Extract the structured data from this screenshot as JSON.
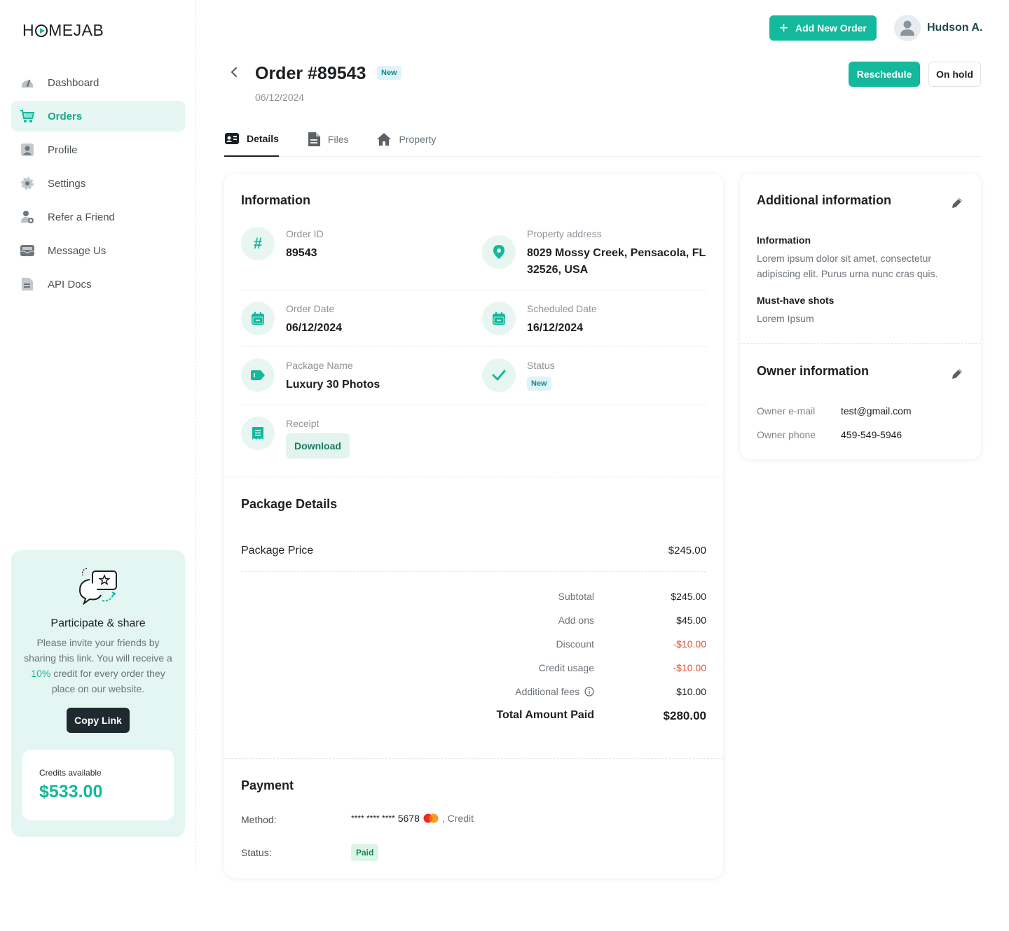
{
  "brand": {
    "logo_text_pre": "H",
    "logo_text_post": "MEJAB"
  },
  "sidebar": {
    "items": [
      {
        "label": "Dashboard",
        "icon": "dashboard-icon"
      },
      {
        "label": "Orders",
        "icon": "cart-icon",
        "active": true
      },
      {
        "label": "Profile",
        "icon": "profile-icon"
      },
      {
        "label": "Settings",
        "icon": "gear-icon"
      },
      {
        "label": "Refer a Friend",
        "icon": "refer-friend-icon"
      },
      {
        "label": "Message Us",
        "icon": "inbox-icon"
      },
      {
        "label": "API Docs",
        "icon": "document-icon"
      }
    ],
    "promo": {
      "title": "Participate & share",
      "text_before": "Please invite your friends by sharing this link. You will receive a ",
      "highlight": "10%",
      "text_after": " credit for every order they place on our website.",
      "button": "Copy Link",
      "credits_label": "Credits available",
      "credits_value": "$533.00"
    }
  },
  "topbar": {
    "add_order": "Add New Order",
    "user_name": "Hudson A."
  },
  "header": {
    "title": "Order #89543",
    "badge": "New",
    "date": "06/12/2024",
    "reschedule": "Reschedule",
    "on_hold": "On hold"
  },
  "tabs": [
    {
      "label": "Details",
      "icon": "id-card-icon",
      "active": true
    },
    {
      "label": "Files",
      "icon": "file-icon"
    },
    {
      "label": "Property",
      "icon": "home-icon"
    }
  ],
  "information": {
    "title": "Information",
    "order_id_label": "Order ID",
    "order_id": "89543",
    "address_label": "Property address",
    "address_line1": "8029 Mossy Creek, Pensacola, FL",
    "address_line2": "32526, USA",
    "order_date_label": "Order Date",
    "order_date": "06/12/2024",
    "scheduled_label": "Scheduled Date",
    "scheduled_date": "16/12/2024",
    "package_label": "Package Name",
    "package_name": "Luxury 30 Photos",
    "status_label": "Status",
    "status": "New",
    "receipt_label": "Receipt",
    "receipt_button": "Download"
  },
  "package": {
    "title": "Package Details",
    "price_label": "Package Price",
    "price": "$245.00",
    "summary": {
      "subtotal_label": "Subtotal",
      "subtotal": "$245.00",
      "addons_label": "Add ons",
      "addons": "$45.00",
      "discount_label": "Discount",
      "discount": "-$10.00",
      "credit_label": "Credit usage",
      "credit": "-$10.00",
      "fees_label": "Additional fees",
      "fees": "$10.00",
      "total_label": "Total Amount Paid",
      "total": "$280.00"
    }
  },
  "payment": {
    "title": "Payment",
    "method_label": "Method:",
    "card_mask": "**** **** ****",
    "card_last4": "5678",
    "card_type": ", Credit",
    "status_label": "Status:",
    "status": "Paid"
  },
  "additional": {
    "title": "Additional information",
    "info_heading": "Information",
    "info_text": "Lorem ipsum dolor sit amet, consectetur adipiscing elit. Purus urna nunc cras quis.",
    "shots_heading": "Must-have shots",
    "shots_text": "Lorem Ipsum"
  },
  "owner": {
    "title": "Owner information",
    "email_label": "Owner e-mail",
    "email": "test@gmail.com",
    "phone_label": "Owner phone",
    "phone": "459-549-5946"
  },
  "colors": {
    "accent": "#14b89c",
    "negative": "#e2573b",
    "dark_button": "#1f2a30"
  }
}
